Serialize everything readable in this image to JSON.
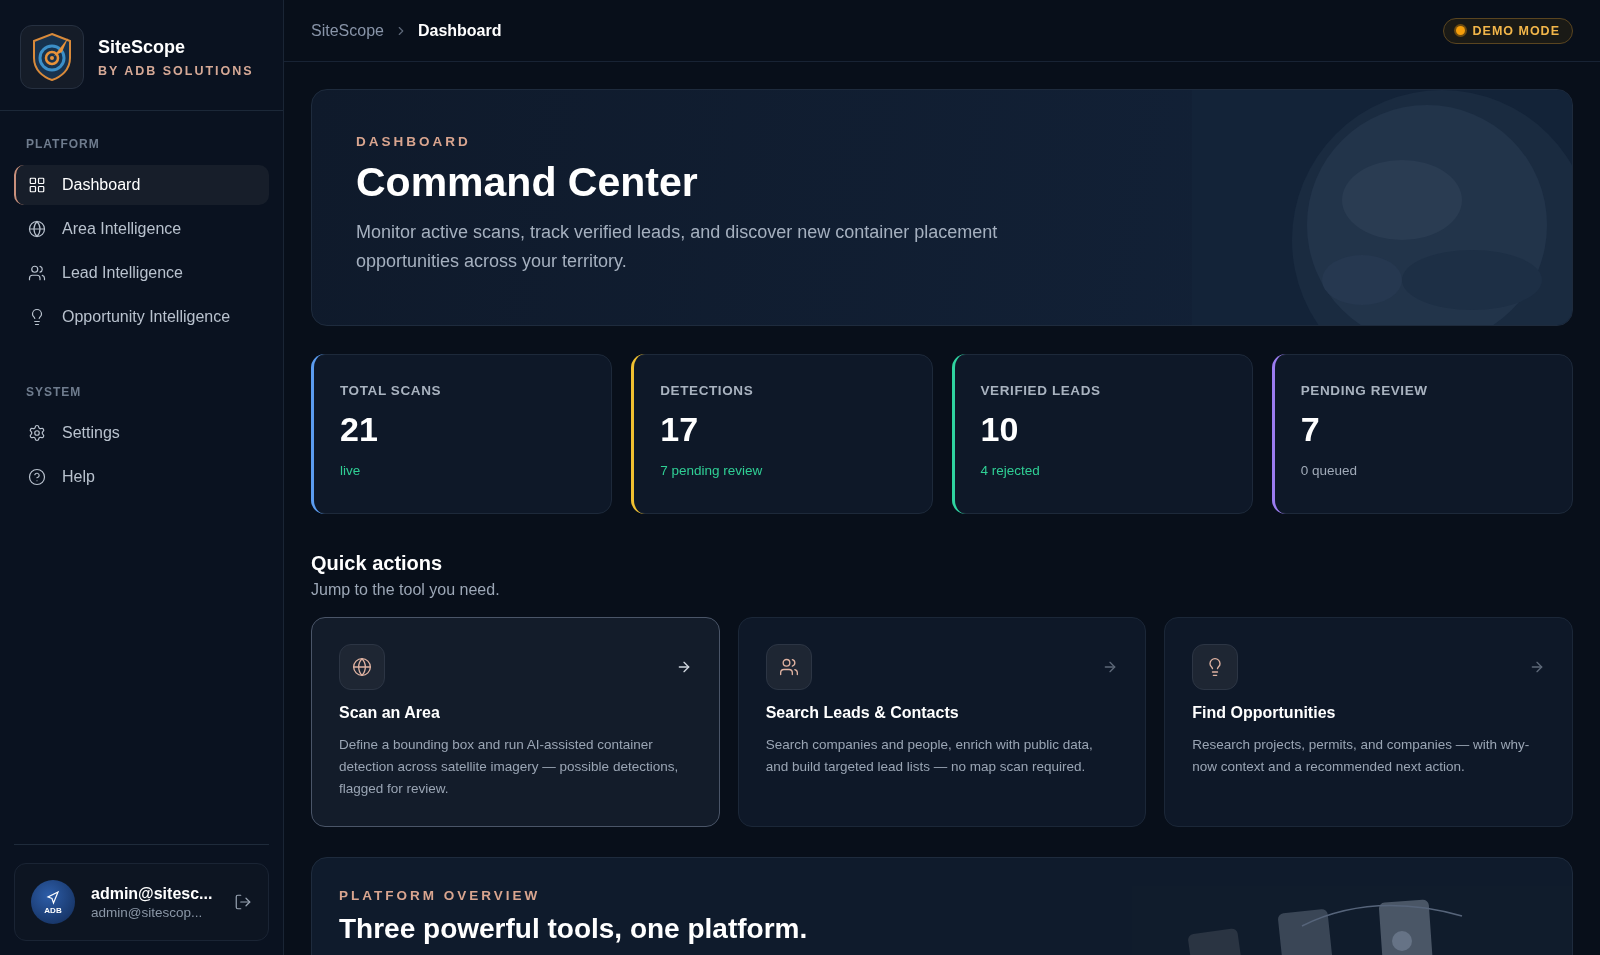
{
  "sidebar": {
    "brand": {
      "name": "SiteScope",
      "tagline": "BY ADB SOLUTIONS"
    },
    "sections": [
      {
        "title": "PLATFORM",
        "items": [
          {
            "label": "Dashboard",
            "kind": "grid",
            "selected": true
          },
          {
            "label": "Area Intelligence",
            "kind": "globe",
            "selected": false
          },
          {
            "label": "Lead Intelligence",
            "kind": "users",
            "selected": false
          },
          {
            "label": "Opportunity Intelligence",
            "kind": "bulb",
            "selected": false
          }
        ]
      },
      {
        "title": "SYSTEM",
        "items": [
          {
            "label": "Settings",
            "kind": "gear",
            "selected": false
          },
          {
            "label": "Help",
            "kind": "help",
            "selected": false
          }
        ]
      }
    ],
    "user": {
      "avatar_text": "ADB",
      "name": "admin@sitesc...",
      "email": "admin@sitescop..."
    }
  },
  "topbar": {
    "breadcrumb": [
      "SiteScope",
      "Dashboard"
    ],
    "badge": "DEMO MODE"
  },
  "hero": {
    "eyebrow": "DASHBOARD",
    "title": "Command Center",
    "description": "Monitor active scans, track verified leads, and discover new container placement opportunities across your territory."
  },
  "stats": [
    {
      "label": "TOTAL SCANS",
      "value": "21",
      "note": "live",
      "color": "#5b9cf0",
      "kind": "positive"
    },
    {
      "label": "DETECTIONS",
      "value": "17",
      "note": "7 pending review",
      "color": "#f0c030",
      "kind": "positive"
    },
    {
      "label": "VERIFIED LEADS",
      "value": "10",
      "note": "4 rejected",
      "color": "#2fd3a0",
      "kind": "positive"
    },
    {
      "label": "PENDING REVIEW",
      "value": "7",
      "note": "0 queued",
      "color": "#9b7cf0",
      "kind": "muted"
    }
  ],
  "quick_actions": {
    "title": "Quick actions",
    "subtitle": "Jump to the tool you need.",
    "cards": [
      {
        "kind": "globe",
        "title": "Scan an Area",
        "description": "Define a bounding box and run AI-assisted container detection across satellite imagery — possible detections, flagged for review.",
        "selected": true
      },
      {
        "kind": "users",
        "title": "Search Leads & Contacts",
        "description": "Search companies and people, enrich with public data, and build targeted lead lists — no map scan required.",
        "selected": false
      },
      {
        "kind": "bulb",
        "title": "Find Opportunities",
        "description": "Research projects, permits, and companies — with why-now context and a recommended next action.",
        "selected": false
      }
    ]
  },
  "overview": {
    "eyebrow": "PLATFORM OVERVIEW",
    "title": "Three powerful tools, one platform."
  }
}
